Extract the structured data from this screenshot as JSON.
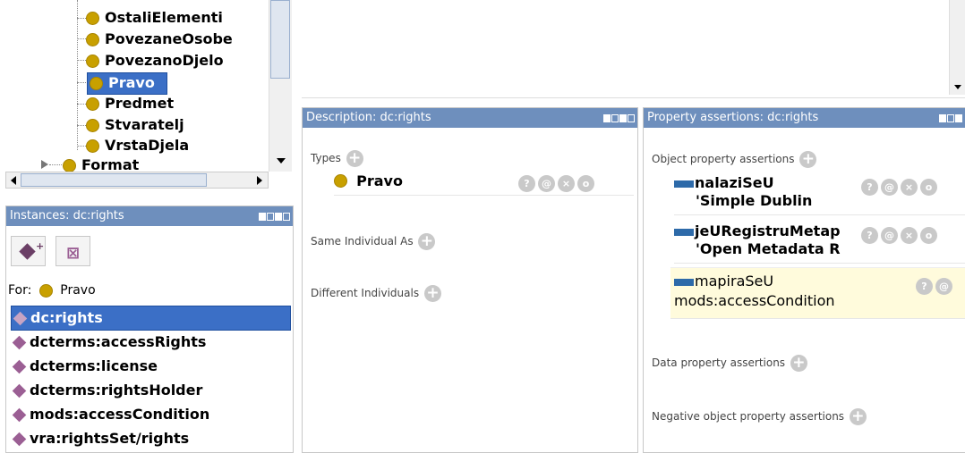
{
  "class_tree": {
    "items": [
      {
        "label": "OstaliElementi"
      },
      {
        "label": "PovezaneOsobe"
      },
      {
        "label": "PovezanoDjelo"
      },
      {
        "label": "Pravo",
        "selected": true
      },
      {
        "label": "Predmet"
      },
      {
        "label": "Stvaratelj"
      },
      {
        "label": "VrstaDjela"
      }
    ],
    "parent": {
      "label": "Format"
    }
  },
  "instances": {
    "title": "Instances: dc:rights",
    "for_label": "For:",
    "for_class": "Pravo",
    "items": [
      {
        "label": "dc:rights",
        "selected": true
      },
      {
        "label": "dcterms:accessRights"
      },
      {
        "label": "dcterms:license"
      },
      {
        "label": "dcterms:rightsHolder"
      },
      {
        "label": "mods:accessCondition"
      },
      {
        "label": "vra:rightsSet/rights"
      }
    ]
  },
  "description": {
    "title": "Description: dc:rights",
    "types_label": "Types",
    "type_value": "Pravo",
    "same_individual_label": "Same Individual As",
    "different_individuals_label": "Different Individuals"
  },
  "property_assertions": {
    "title": "Property assertions: dc:rights",
    "object_label": "Object property assertions",
    "assertions": [
      {
        "property": "nalaziSeU",
        "value": "'Simple Dublin"
      },
      {
        "property": "jeURegistruMetap",
        "value": "'Open Metadata R"
      },
      {
        "property": "mapiraSeU",
        "value": "mods:accessCondition",
        "highlighted": true
      }
    ],
    "data_label": "Data property assertions",
    "negative_label": "Negative object property assertions"
  },
  "buttons": {
    "help": "?",
    "annotate": "@",
    "delete": "×",
    "edit": "o"
  },
  "colors": {
    "header": "#6e8fbd",
    "selection": "#3b6fc6",
    "individual": "#9b5f94",
    "class": "#c8a000",
    "object_property": "#2d6aa9",
    "highlight_row": "#fffbdc"
  }
}
